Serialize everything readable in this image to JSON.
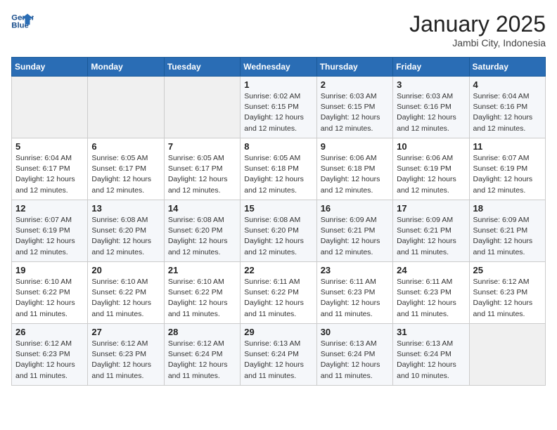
{
  "header": {
    "logo_line1": "General",
    "logo_line2": "Blue",
    "month": "January 2025",
    "location": "Jambi City, Indonesia"
  },
  "weekdays": [
    "Sunday",
    "Monday",
    "Tuesday",
    "Wednesday",
    "Thursday",
    "Friday",
    "Saturday"
  ],
  "weeks": [
    [
      {
        "day": "",
        "info": ""
      },
      {
        "day": "",
        "info": ""
      },
      {
        "day": "",
        "info": ""
      },
      {
        "day": "1",
        "info": "Sunrise: 6:02 AM\nSunset: 6:15 PM\nDaylight: 12 hours\nand 12 minutes."
      },
      {
        "day": "2",
        "info": "Sunrise: 6:03 AM\nSunset: 6:15 PM\nDaylight: 12 hours\nand 12 minutes."
      },
      {
        "day": "3",
        "info": "Sunrise: 6:03 AM\nSunset: 6:16 PM\nDaylight: 12 hours\nand 12 minutes."
      },
      {
        "day": "4",
        "info": "Sunrise: 6:04 AM\nSunset: 6:16 PM\nDaylight: 12 hours\nand 12 minutes."
      }
    ],
    [
      {
        "day": "5",
        "info": "Sunrise: 6:04 AM\nSunset: 6:17 PM\nDaylight: 12 hours\nand 12 minutes."
      },
      {
        "day": "6",
        "info": "Sunrise: 6:05 AM\nSunset: 6:17 PM\nDaylight: 12 hours\nand 12 minutes."
      },
      {
        "day": "7",
        "info": "Sunrise: 6:05 AM\nSunset: 6:17 PM\nDaylight: 12 hours\nand 12 minutes."
      },
      {
        "day": "8",
        "info": "Sunrise: 6:05 AM\nSunset: 6:18 PM\nDaylight: 12 hours\nand 12 minutes."
      },
      {
        "day": "9",
        "info": "Sunrise: 6:06 AM\nSunset: 6:18 PM\nDaylight: 12 hours\nand 12 minutes."
      },
      {
        "day": "10",
        "info": "Sunrise: 6:06 AM\nSunset: 6:19 PM\nDaylight: 12 hours\nand 12 minutes."
      },
      {
        "day": "11",
        "info": "Sunrise: 6:07 AM\nSunset: 6:19 PM\nDaylight: 12 hours\nand 12 minutes."
      }
    ],
    [
      {
        "day": "12",
        "info": "Sunrise: 6:07 AM\nSunset: 6:19 PM\nDaylight: 12 hours\nand 12 minutes."
      },
      {
        "day": "13",
        "info": "Sunrise: 6:08 AM\nSunset: 6:20 PM\nDaylight: 12 hours\nand 12 minutes."
      },
      {
        "day": "14",
        "info": "Sunrise: 6:08 AM\nSunset: 6:20 PM\nDaylight: 12 hours\nand 12 minutes."
      },
      {
        "day": "15",
        "info": "Sunrise: 6:08 AM\nSunset: 6:20 PM\nDaylight: 12 hours\nand 12 minutes."
      },
      {
        "day": "16",
        "info": "Sunrise: 6:09 AM\nSunset: 6:21 PM\nDaylight: 12 hours\nand 12 minutes."
      },
      {
        "day": "17",
        "info": "Sunrise: 6:09 AM\nSunset: 6:21 PM\nDaylight: 12 hours\nand 11 minutes."
      },
      {
        "day": "18",
        "info": "Sunrise: 6:09 AM\nSunset: 6:21 PM\nDaylight: 12 hours\nand 11 minutes."
      }
    ],
    [
      {
        "day": "19",
        "info": "Sunrise: 6:10 AM\nSunset: 6:22 PM\nDaylight: 12 hours\nand 11 minutes."
      },
      {
        "day": "20",
        "info": "Sunrise: 6:10 AM\nSunset: 6:22 PM\nDaylight: 12 hours\nand 11 minutes."
      },
      {
        "day": "21",
        "info": "Sunrise: 6:10 AM\nSunset: 6:22 PM\nDaylight: 12 hours\nand 11 minutes."
      },
      {
        "day": "22",
        "info": "Sunrise: 6:11 AM\nSunset: 6:22 PM\nDaylight: 12 hours\nand 11 minutes."
      },
      {
        "day": "23",
        "info": "Sunrise: 6:11 AM\nSunset: 6:23 PM\nDaylight: 12 hours\nand 11 minutes."
      },
      {
        "day": "24",
        "info": "Sunrise: 6:11 AM\nSunset: 6:23 PM\nDaylight: 12 hours\nand 11 minutes."
      },
      {
        "day": "25",
        "info": "Sunrise: 6:12 AM\nSunset: 6:23 PM\nDaylight: 12 hours\nand 11 minutes."
      }
    ],
    [
      {
        "day": "26",
        "info": "Sunrise: 6:12 AM\nSunset: 6:23 PM\nDaylight: 12 hours\nand 11 minutes."
      },
      {
        "day": "27",
        "info": "Sunrise: 6:12 AM\nSunset: 6:23 PM\nDaylight: 12 hours\nand 11 minutes."
      },
      {
        "day": "28",
        "info": "Sunrise: 6:12 AM\nSunset: 6:24 PM\nDaylight: 12 hours\nand 11 minutes."
      },
      {
        "day": "29",
        "info": "Sunrise: 6:13 AM\nSunset: 6:24 PM\nDaylight: 12 hours\nand 11 minutes."
      },
      {
        "day": "30",
        "info": "Sunrise: 6:13 AM\nSunset: 6:24 PM\nDaylight: 12 hours\nand 11 minutes."
      },
      {
        "day": "31",
        "info": "Sunrise: 6:13 AM\nSunset: 6:24 PM\nDaylight: 12 hours\nand 10 minutes."
      },
      {
        "day": "",
        "info": ""
      }
    ]
  ]
}
